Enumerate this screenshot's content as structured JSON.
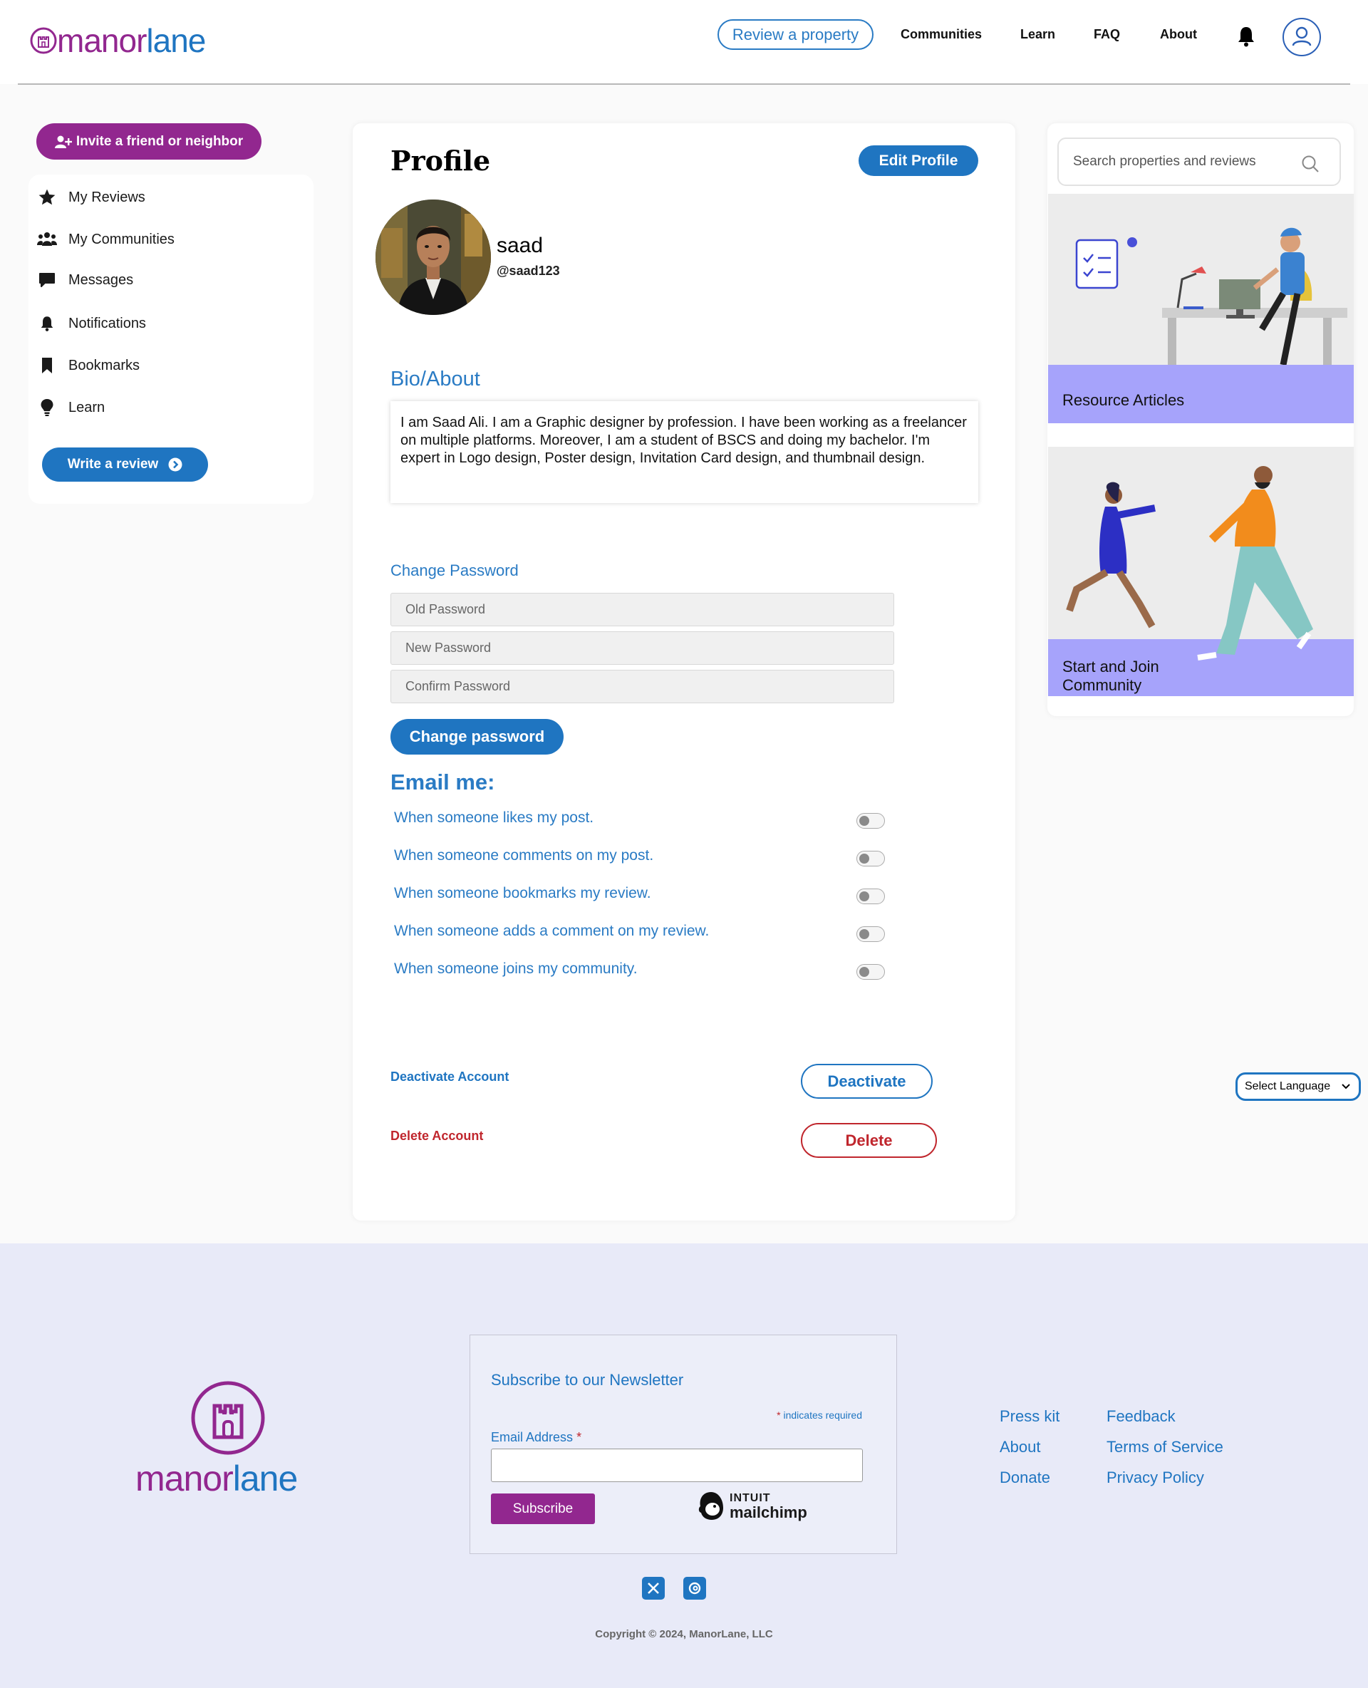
{
  "header": {
    "logo_manor": "manor",
    "logo_lane": "lane",
    "review_property": "Review a property",
    "nav": [
      "Communities",
      "Learn",
      "FAQ",
      "About"
    ]
  },
  "sidebar": {
    "invite_label": "Invite a friend or neighbor",
    "items": [
      {
        "label": "My Reviews",
        "icon": "star-icon"
      },
      {
        "label": "My Communities",
        "icon": "users-icon"
      },
      {
        "label": "Messages",
        "icon": "message-icon"
      },
      {
        "label": "Notifications",
        "icon": "bell-icon"
      },
      {
        "label": "Bookmarks",
        "icon": "bookmark-icon"
      },
      {
        "label": "Learn",
        "icon": "lightbulb-icon"
      }
    ],
    "write_review": "Write a review"
  },
  "profile": {
    "title": "Profile",
    "edit_label": "Edit Profile",
    "name": "saad",
    "handle": "@saad123",
    "bio_title": "Bio/About",
    "bio": "I am Saad Ali. I am a Graphic designer by profession. I have been working as a freelancer on multiple platforms. Moreover, I am a student of BSCS and doing my bachelor. I'm expert in Logo design, Poster design, Invitation Card design, and thumbnail design.",
    "change_password_title": "Change Password",
    "old_password_placeholder": "Old Password",
    "new_password_placeholder": "New Password",
    "confirm_password_placeholder": "Confirm Password",
    "change_password_button": "Change password",
    "email_title": "Email me:",
    "email_options": [
      {
        "label": "When someone likes my post.",
        "enabled": false
      },
      {
        "label": "When someone comments on my post.",
        "enabled": false
      },
      {
        "label": "When someone bookmarks my review.",
        "enabled": false
      },
      {
        "label": "When someone adds a comment on my review.",
        "enabled": false
      },
      {
        "label": "When someone joins my community.",
        "enabled": false
      }
    ],
    "deactivate_label": "Deactivate Account",
    "deactivate_button": "Deactivate",
    "delete_label": "Delete Account",
    "delete_button": "Delete"
  },
  "right": {
    "search_placeholder": "Search properties and reviews",
    "promo_1": "Resource Articles",
    "promo_2_line1": "Start and Join",
    "promo_2_line2": "Community"
  },
  "footer": {
    "logo_manor": "manor",
    "logo_lane": "lane",
    "newsletter_title": "Subscribe to our Newsletter",
    "required_note": "indicates required",
    "required_star": "*",
    "email_label": "Email Address",
    "subscribe": "Subscribe",
    "mailchimp_top": "INTUIT",
    "mailchimp_main": "mailchimp",
    "links_col1": [
      "Press kit",
      "About",
      "Donate"
    ],
    "links_col2": [
      "Feedback",
      "Terms of Service",
      "Privacy Policy"
    ],
    "copyright": "Copyright © 2024, ManorLane, LLC",
    "language": "Select Language"
  },
  "colors": {
    "brand_purple": "#92278f",
    "brand_blue": "#1f75c1",
    "danger": "#c0262d",
    "promo_band": "#a6a3fb"
  }
}
